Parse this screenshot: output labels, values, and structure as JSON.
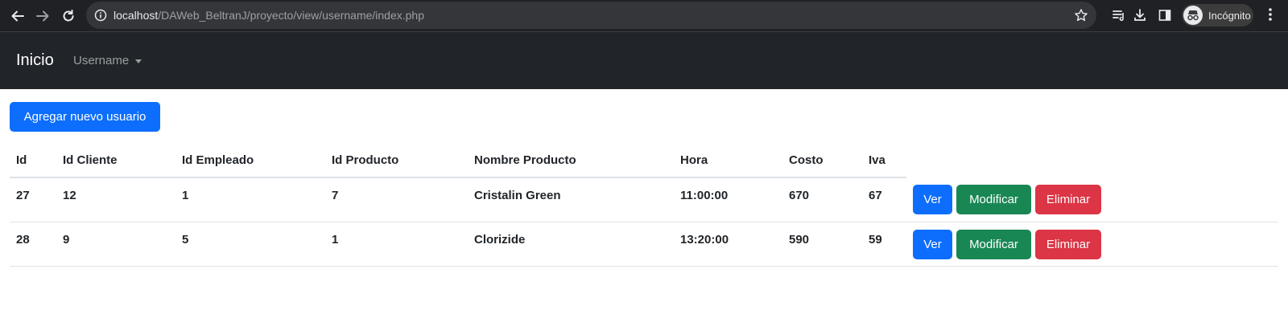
{
  "browser": {
    "url_host": "localhost",
    "url_path": "/DAWeb_BeltranJ/proyecto/view/username/index.php",
    "profile_label": "Incógnito"
  },
  "navbar": {
    "brand": "Inicio",
    "dropdown_label": "Username"
  },
  "page": {
    "add_button": "Agregar nuevo usuario"
  },
  "table": {
    "headers": [
      "Id",
      "Id Cliente",
      "Id Empleado",
      "Id Producto",
      "Nombre Producto",
      "Hora",
      "Costo",
      "Iva"
    ],
    "rows": [
      {
        "id": "27",
        "id_cliente": "12",
        "id_empleado": "1",
        "id_producto": "7",
        "nombre_producto": "Cristalin Green",
        "hora": "11:00:00",
        "costo": "670",
        "iva": "67"
      },
      {
        "id": "28",
        "id_cliente": "9",
        "id_empleado": "5",
        "id_producto": "1",
        "nombre_producto": "Clorizide",
        "hora": "13:20:00",
        "costo": "590",
        "iva": "59"
      }
    ],
    "actions": {
      "view": "Ver",
      "edit": "Modificar",
      "delete": "Eliminar"
    }
  },
  "colors": {
    "primary": "#0d6efd",
    "success": "#198754",
    "danger": "#dc3545",
    "navbar_bg": "#212529"
  }
}
